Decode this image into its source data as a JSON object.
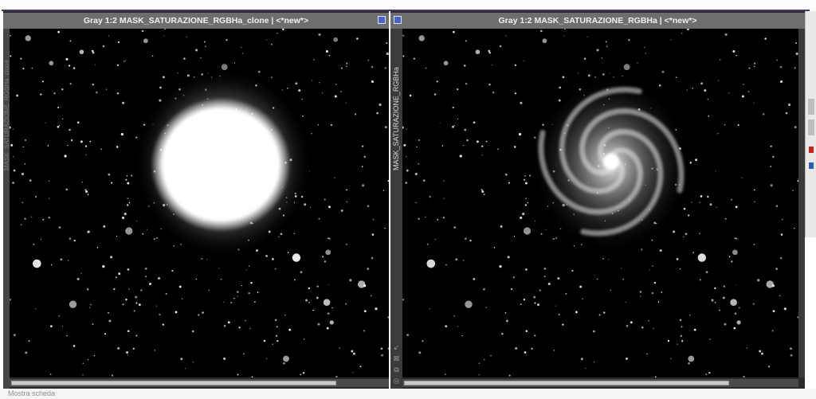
{
  "windows": [
    {
      "title": "Gray 1:2 MASK_SATURAZIONE_RGBHa_clone | <*new*>",
      "side_label": "MASK_SATURAZIONE_RGBHa_clone",
      "image": "saturated-galaxy-mask"
    },
    {
      "title": "Gray 1:2 MASK_SATURAZIONE_RGBHa | <*new*>",
      "side_label": "MASK_SATURAZIONE_RGBHa",
      "image": "spiral-galaxy-mask"
    }
  ],
  "side_icons": [
    "arrow-icon",
    "fit-icon",
    "copy-icon",
    "target-icon"
  ],
  "statusbar": {
    "left_text": "Mostra scheda",
    "right_text": ""
  },
  "colors": {
    "background": "#000000",
    "titlebar": "#6e6e6e",
    "window_frame": "#2b2b2b"
  }
}
